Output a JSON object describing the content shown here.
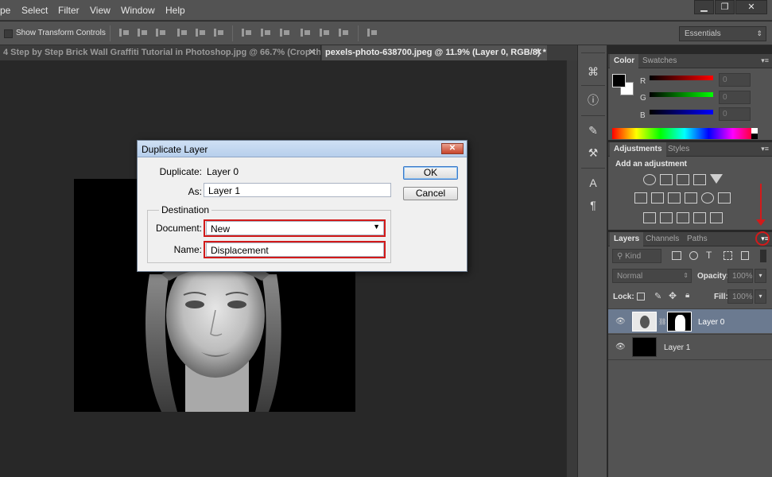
{
  "menubar": {
    "items": [
      "pe",
      "Select",
      "Filter",
      "View",
      "Window",
      "Help"
    ],
    "window_controls": [
      "▁",
      "❐",
      "✕"
    ]
  },
  "options": {
    "show_transform_controls": "Show Transform Controls",
    "workspace": "Essentials",
    "workspace_arrow": "⇕"
  },
  "tabs": [
    {
      "label": "4 Step by Step Brick Wall Graffiti Tutorial in Photoshop.jpg @ 66.7% (Crop the...",
      "close": "✕",
      "active": false
    },
    {
      "label": "pexels-photo-638700.jpeg @ 11.9% (Layer 0, RGB/8) *",
      "close": "✕",
      "active": true
    }
  ],
  "tool_dock": [
    "histogram-icon",
    "info-icon",
    "brush-settings-icon",
    "tool-presets-icon",
    "character-icon",
    "paragraph-icon"
  ],
  "color_panel": {
    "tabs": [
      "Color",
      "Swatches"
    ],
    "channels": [
      {
        "label": "R",
        "value": "0",
        "color": "#ff0000"
      },
      {
        "label": "G",
        "value": "0",
        "color": "#00ff00"
      },
      {
        "label": "B",
        "value": "0",
        "color": "#0000ff"
      }
    ]
  },
  "adjustments_panel": {
    "tabs": [
      "Adjustments",
      "Styles"
    ],
    "heading": "Add an adjustment"
  },
  "layers_panel": {
    "tabs": [
      "Layers",
      "Channels",
      "Paths"
    ],
    "kind_label": "Kind",
    "blend_mode": "Normal",
    "opacity_label": "Opacity:",
    "opacity_value": "100%",
    "lock_label": "Lock:",
    "fill_label": "Fill:",
    "fill_value": "100%",
    "layers": [
      {
        "name": "Layer 0",
        "selected": true
      },
      {
        "name": "Layer 1",
        "selected": false
      }
    ]
  },
  "dialog": {
    "title": "Duplicate Layer",
    "close": "✕",
    "duplicate_label": "Duplicate:",
    "duplicate_value": "Layer 0",
    "as_label": "As:",
    "as_value": "Layer 1",
    "destination_label": "Destination",
    "document_label": "Document:",
    "document_value": "New",
    "name_label": "Name:",
    "name_value": "Displacement",
    "ok_label": "OK",
    "cancel_label": "Cancel"
  },
  "colors": {
    "annotation": "#d21a1a",
    "panel": "#535353",
    "canvas": "#282828"
  }
}
